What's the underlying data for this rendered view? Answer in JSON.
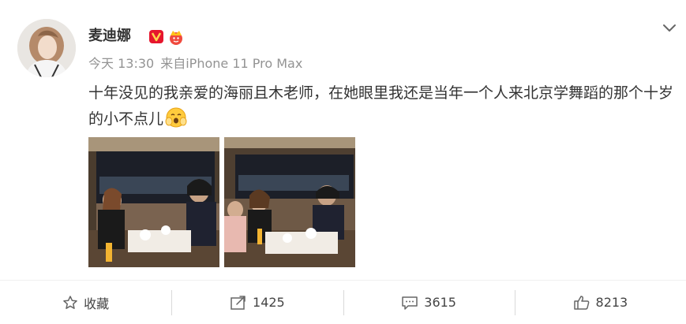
{
  "user": {
    "name": "麦迪娜"
  },
  "meta": {
    "time": "今天 13:30",
    "source_prefix": "来自",
    "source": "iPhone 11 Pro Max"
  },
  "post": {
    "text": "十年没见的我亲爱的海丽且木老师，在她眼里我还是当年一个人来北京学舞蹈的那个十岁的小不点儿",
    "emoji": "blush-face-emoji"
  },
  "actions": {
    "favorite_label": "收藏",
    "repost_count": "1425",
    "comment_count": "3615",
    "like_count": "8213"
  },
  "colors": {
    "text": "#333333",
    "meta": "#939393",
    "vip_red": "#e6162d",
    "icon_gray": "#666666"
  }
}
